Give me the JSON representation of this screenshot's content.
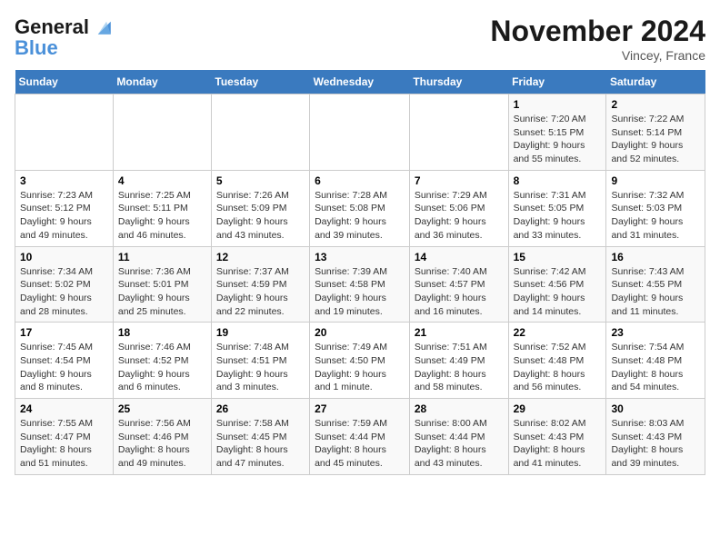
{
  "header": {
    "logo_line1": "General",
    "logo_line2": "Blue",
    "month": "November 2024",
    "location": "Vincey, France"
  },
  "weekdays": [
    "Sunday",
    "Monday",
    "Tuesday",
    "Wednesday",
    "Thursday",
    "Friday",
    "Saturday"
  ],
  "weeks": [
    [
      {
        "day": "",
        "info": ""
      },
      {
        "day": "",
        "info": ""
      },
      {
        "day": "",
        "info": ""
      },
      {
        "day": "",
        "info": ""
      },
      {
        "day": "",
        "info": ""
      },
      {
        "day": "1",
        "info": "Sunrise: 7:20 AM\nSunset: 5:15 PM\nDaylight: 9 hours and 55 minutes."
      },
      {
        "day": "2",
        "info": "Sunrise: 7:22 AM\nSunset: 5:14 PM\nDaylight: 9 hours and 52 minutes."
      }
    ],
    [
      {
        "day": "3",
        "info": "Sunrise: 7:23 AM\nSunset: 5:12 PM\nDaylight: 9 hours and 49 minutes."
      },
      {
        "day": "4",
        "info": "Sunrise: 7:25 AM\nSunset: 5:11 PM\nDaylight: 9 hours and 46 minutes."
      },
      {
        "day": "5",
        "info": "Sunrise: 7:26 AM\nSunset: 5:09 PM\nDaylight: 9 hours and 43 minutes."
      },
      {
        "day": "6",
        "info": "Sunrise: 7:28 AM\nSunset: 5:08 PM\nDaylight: 9 hours and 39 minutes."
      },
      {
        "day": "7",
        "info": "Sunrise: 7:29 AM\nSunset: 5:06 PM\nDaylight: 9 hours and 36 minutes."
      },
      {
        "day": "8",
        "info": "Sunrise: 7:31 AM\nSunset: 5:05 PM\nDaylight: 9 hours and 33 minutes."
      },
      {
        "day": "9",
        "info": "Sunrise: 7:32 AM\nSunset: 5:03 PM\nDaylight: 9 hours and 31 minutes."
      }
    ],
    [
      {
        "day": "10",
        "info": "Sunrise: 7:34 AM\nSunset: 5:02 PM\nDaylight: 9 hours and 28 minutes."
      },
      {
        "day": "11",
        "info": "Sunrise: 7:36 AM\nSunset: 5:01 PM\nDaylight: 9 hours and 25 minutes."
      },
      {
        "day": "12",
        "info": "Sunrise: 7:37 AM\nSunset: 4:59 PM\nDaylight: 9 hours and 22 minutes."
      },
      {
        "day": "13",
        "info": "Sunrise: 7:39 AM\nSunset: 4:58 PM\nDaylight: 9 hours and 19 minutes."
      },
      {
        "day": "14",
        "info": "Sunrise: 7:40 AM\nSunset: 4:57 PM\nDaylight: 9 hours and 16 minutes."
      },
      {
        "day": "15",
        "info": "Sunrise: 7:42 AM\nSunset: 4:56 PM\nDaylight: 9 hours and 14 minutes."
      },
      {
        "day": "16",
        "info": "Sunrise: 7:43 AM\nSunset: 4:55 PM\nDaylight: 9 hours and 11 minutes."
      }
    ],
    [
      {
        "day": "17",
        "info": "Sunrise: 7:45 AM\nSunset: 4:54 PM\nDaylight: 9 hours and 8 minutes."
      },
      {
        "day": "18",
        "info": "Sunrise: 7:46 AM\nSunset: 4:52 PM\nDaylight: 9 hours and 6 minutes."
      },
      {
        "day": "19",
        "info": "Sunrise: 7:48 AM\nSunset: 4:51 PM\nDaylight: 9 hours and 3 minutes."
      },
      {
        "day": "20",
        "info": "Sunrise: 7:49 AM\nSunset: 4:50 PM\nDaylight: 9 hours and 1 minute."
      },
      {
        "day": "21",
        "info": "Sunrise: 7:51 AM\nSunset: 4:49 PM\nDaylight: 8 hours and 58 minutes."
      },
      {
        "day": "22",
        "info": "Sunrise: 7:52 AM\nSunset: 4:48 PM\nDaylight: 8 hours and 56 minutes."
      },
      {
        "day": "23",
        "info": "Sunrise: 7:54 AM\nSunset: 4:48 PM\nDaylight: 8 hours and 54 minutes."
      }
    ],
    [
      {
        "day": "24",
        "info": "Sunrise: 7:55 AM\nSunset: 4:47 PM\nDaylight: 8 hours and 51 minutes."
      },
      {
        "day": "25",
        "info": "Sunrise: 7:56 AM\nSunset: 4:46 PM\nDaylight: 8 hours and 49 minutes."
      },
      {
        "day": "26",
        "info": "Sunrise: 7:58 AM\nSunset: 4:45 PM\nDaylight: 8 hours and 47 minutes."
      },
      {
        "day": "27",
        "info": "Sunrise: 7:59 AM\nSunset: 4:44 PM\nDaylight: 8 hours and 45 minutes."
      },
      {
        "day": "28",
        "info": "Sunrise: 8:00 AM\nSunset: 4:44 PM\nDaylight: 8 hours and 43 minutes."
      },
      {
        "day": "29",
        "info": "Sunrise: 8:02 AM\nSunset: 4:43 PM\nDaylight: 8 hours and 41 minutes."
      },
      {
        "day": "30",
        "info": "Sunrise: 8:03 AM\nSunset: 4:43 PM\nDaylight: 8 hours and 39 minutes."
      }
    ]
  ]
}
